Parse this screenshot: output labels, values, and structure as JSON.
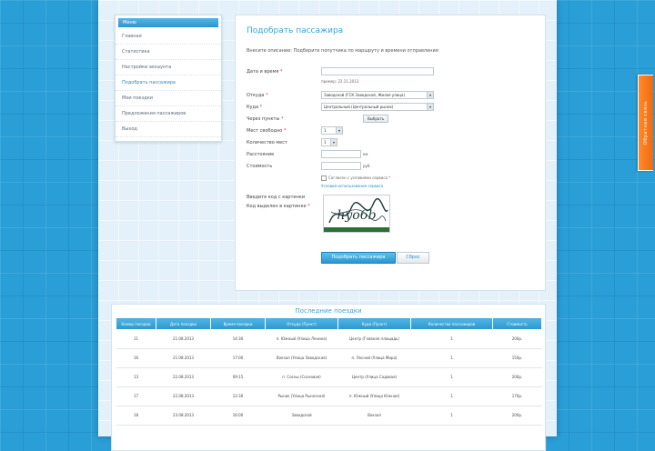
{
  "sidebar": {
    "title": "Меню",
    "items": [
      {
        "label": "Главная",
        "active": false
      },
      {
        "label": "Статистика",
        "active": false
      },
      {
        "label": "Настройки аккаунта",
        "active": false
      },
      {
        "label": "Подобрать пассажира",
        "active": true
      },
      {
        "label": "Мои поездки",
        "active": false
      },
      {
        "label": "Предложения пассажиров",
        "active": false
      },
      {
        "label": "Выход",
        "active": false
      }
    ]
  },
  "form": {
    "title": "Подобрать пассажира",
    "intro": "Внесите описание: Подберите попутчика по маршруту и времени отправления",
    "fields": {
      "datetime_label": "Дата и время",
      "datetime_value": "",
      "datetime_hint": "пример: 22.11.2013",
      "from_label": "Откуда",
      "from_value": "Заводской (ГСК Заводской, Жилая улица)",
      "to_label": "Куда",
      "to_value": "Центральный (Центральный рынок)",
      "route_label": "Через пункты",
      "route_button": "Выбрать",
      "seats_label": "Мест свободно",
      "seats_value": "1",
      "luggage_label": "Количество мест",
      "luggage_value": "1",
      "distance_label": "Расстояние",
      "distance_unit": "км",
      "price_label": "Стоимость",
      "price_unit": "руб.",
      "agree_label": "Согласен с условиями сервиса",
      "agree_link": "Условия использования сервиса",
      "captcha_label": "Введите код с картинки",
      "captcha_note": "Код выделен в картинке",
      "captcha_text": "hyo6b",
      "submit_label": "Подобрать пассажира",
      "cancel_label": "Сброс"
    }
  },
  "table": {
    "title": "Последние поездки",
    "headers": [
      "Номер поездки",
      "Дата поездки",
      "Время поездки",
      "Откуда (Пункт)",
      "Куда (Пункт)",
      "Количество пассажиров",
      "Стоимость"
    ],
    "rows": [
      {
        "cells": [
          "11",
          "21.08.2013",
          "14:30",
          "п. Южный (Улица Ленина)",
          "Центр (Главная площадь)",
          "1",
          "200р."
        ]
      },
      {
        "cells": [
          "16",
          "21.08.2013",
          "17:00",
          "Вокзал (Улица Заводская)",
          "п. Лесной (Улица Мира)",
          "1",
          "150р."
        ]
      },
      {
        "cells": [
          "13",
          "22.08.2013",
          "09:15",
          "п. Сосны (Сосновая)",
          "Центр (Улица Садовая)",
          "1",
          "200р."
        ]
      },
      {
        "cells": [
          "17",
          "22.08.2013",
          "12:30",
          "Рынок (Улица Рыночная)",
          "п. Южный (Улица Южная)",
          "1",
          "170р."
        ]
      },
      {
        "cells": [
          "18",
          "23.08.2013",
          "16:00",
          "Заводской",
          "Вокзал",
          "1",
          "200р."
        ]
      }
    ]
  },
  "feedback": {
    "label": "Обратная связь"
  },
  "colors": {
    "accent": "#2b8bc6",
    "header_blue": "#3aa3d8",
    "feedback_orange": "#f47a1f",
    "background": "#2a9ed6"
  }
}
